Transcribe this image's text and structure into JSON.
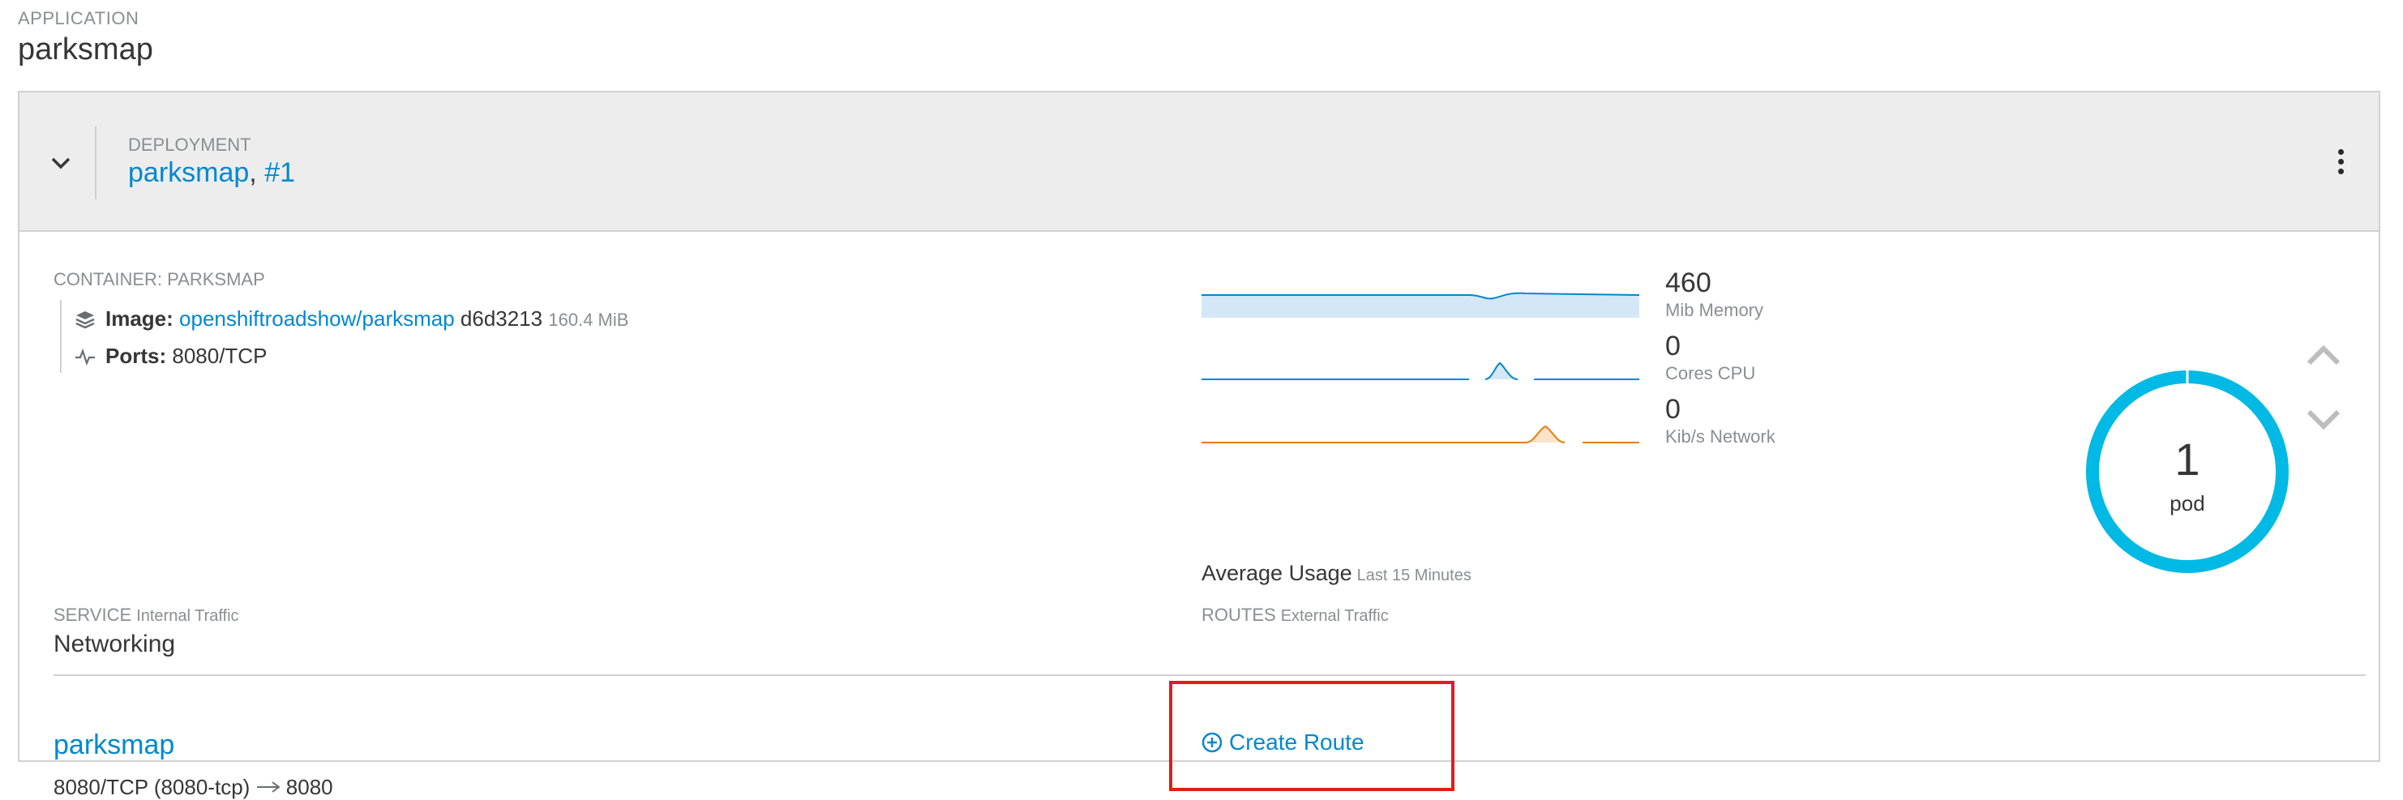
{
  "app": {
    "label": "APPLICATION",
    "name": "parksmap"
  },
  "deployment": {
    "label": "DEPLOYMENT",
    "name": "parksmap",
    "separator": ", ",
    "revision": "#1"
  },
  "container": {
    "label": "CONTAINER: PARKSMAP",
    "image_label": "Image:",
    "image_name": "openshiftroadshow/parksmap",
    "image_hash": "d6d3213",
    "image_size": "160.4 MiB",
    "ports_label": "Ports:",
    "ports_value": "8080/TCP"
  },
  "metrics": {
    "memory": {
      "value": "460",
      "unit": "Mib Memory"
    },
    "cpu": {
      "value": "0",
      "unit": "Cores CPU"
    },
    "network": {
      "value": "0",
      "unit": "Kib/s Network"
    },
    "average_title": "Average Usage",
    "average_sub": "Last 15 Minutes",
    "colors": {
      "memory": "#0088ce",
      "cpu": "#0088ce",
      "network": "#ec7a08"
    }
  },
  "pods": {
    "count": "1",
    "label": "pod",
    "ring_color": "#00b9e4"
  },
  "networking": {
    "title": "Networking",
    "service_label": "SERVICE",
    "service_sub": "Internal Traffic",
    "service_name": "parksmap",
    "service_port_left": "8080/TCP (8080-tcp)",
    "service_port_right": "8080",
    "routes_label": "ROUTES",
    "routes_sub": "External Traffic",
    "create_route": "Create Route"
  },
  "icons": {
    "collapse": "chevron-down-icon",
    "kebab": "kebab-menu-icon",
    "image": "layers-icon",
    "ports": "pulse-icon",
    "scale_up": "chevron-up-icon",
    "scale_down": "chevron-down-icon",
    "create_route": "plus-circle-icon",
    "port_arrow": "arrow-right-icon"
  }
}
